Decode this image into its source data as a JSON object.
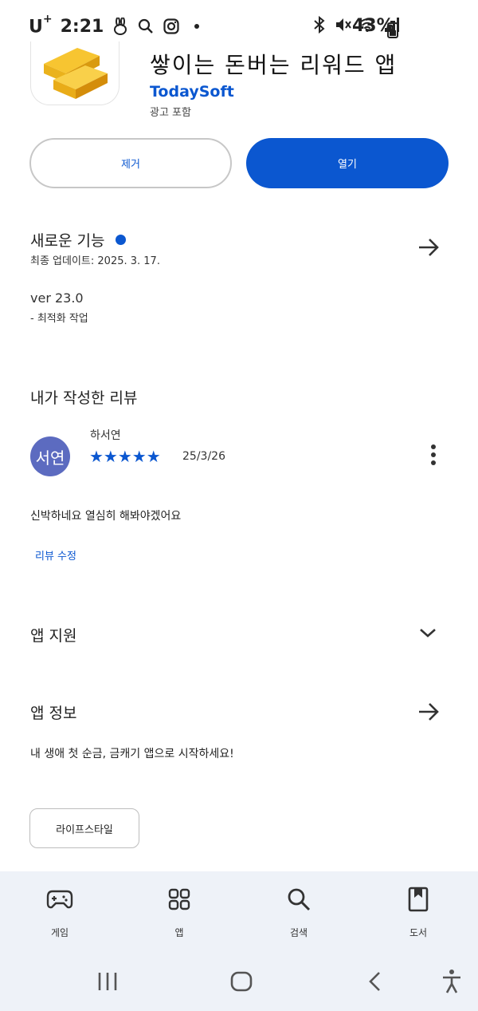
{
  "status_bar": {
    "carrier": "U",
    "carrier_plus": "+",
    "time": "2:21",
    "battery": "43%"
  },
  "app": {
    "title": "쌓이는 돈버는 리워드 앱",
    "developer": "TodaySoft",
    "ads_label": "광고 포함",
    "remove_label": "제거",
    "open_label": "열기"
  },
  "whats_new": {
    "title": "새로운 기능",
    "updated": "최종 업데이트: 2025. 3. 17.",
    "version": "ver 23.0",
    "notes": "- 최적화 작업"
  },
  "my_review": {
    "title": "내가 작성한 리뷰",
    "avatar_text": "서연",
    "reviewer": "하서연",
    "rating": 5,
    "stars": "★★★★★",
    "date": "25/3/26",
    "text": "신박하네요 열심히 해봐야겠어요",
    "edit_label": "리뷰 수정"
  },
  "app_support": {
    "title": "앱 지원"
  },
  "about": {
    "title": "앱 정보",
    "description": "내 생애 첫 순금, 금캐기 앱으로 시작하세요!",
    "category": "라이프스타일"
  },
  "bottom_nav": {
    "items": [
      {
        "label": "게임",
        "icon": "gamepad-icon"
      },
      {
        "label": "앱",
        "icon": "apps-grid-icon"
      },
      {
        "label": "검색",
        "icon": "search-icon"
      },
      {
        "label": "도서",
        "icon": "book-icon"
      }
    ]
  },
  "colors": {
    "accent": "#0b57d0",
    "avatar": "#5c6bc0",
    "nav_bg": "#eef2f8"
  }
}
